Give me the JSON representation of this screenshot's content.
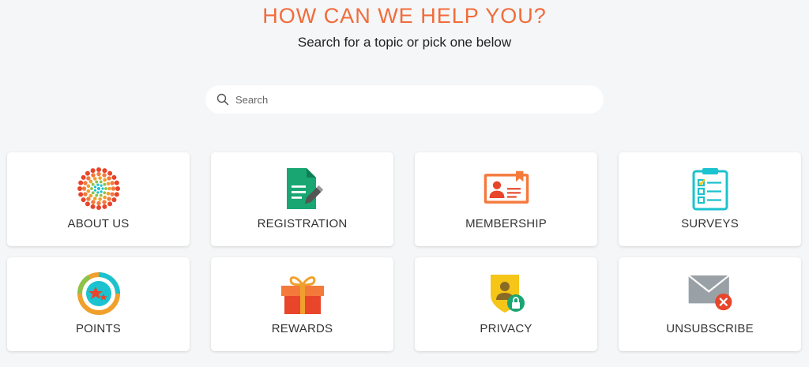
{
  "header": {
    "title": "HOW CAN WE HELP YOU?",
    "subtitle": "Search for a topic or pick one below"
  },
  "search": {
    "placeholder": "Search",
    "value": "",
    "icon": "search-icon"
  },
  "colors": {
    "accent": "#f26b3a",
    "background": "#f4f6f7"
  },
  "topics": [
    {
      "label": "ABOUT US",
      "icon": "sunburst-icon"
    },
    {
      "label": "REGISTRATION",
      "icon": "document-edit-icon"
    },
    {
      "label": "MEMBERSHIP",
      "icon": "id-card-icon"
    },
    {
      "label": "SURVEYS",
      "icon": "clipboard-checklist-icon"
    },
    {
      "label": "POINTS",
      "icon": "star-badge-icon"
    },
    {
      "label": "REWARDS",
      "icon": "gift-icon"
    },
    {
      "label": "PRIVACY",
      "icon": "shield-lock-icon"
    },
    {
      "label": "UNSUBSCRIBE",
      "icon": "envelope-x-icon"
    }
  ]
}
